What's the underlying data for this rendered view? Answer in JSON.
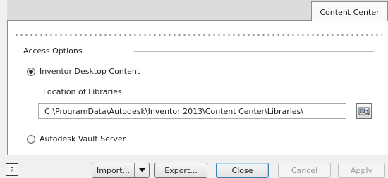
{
  "tabs": {
    "active_label": "Content Center"
  },
  "access_options": {
    "title": "Access Options",
    "desktop_radio": {
      "label": "Inventor Desktop Content",
      "selected": true
    },
    "location_label": "Location of Libraries:",
    "path_value": "C:\\ProgramData\\Autodesk\\Inventor 2013\\Content Center\\Libraries\\",
    "browse_icon": "folder-browse-icon",
    "vault_radio": {
      "label": "Autodesk Vault Server",
      "selected": false
    }
  },
  "footer": {
    "help_icon": "question-mark-icon",
    "import_label": "Import...",
    "export_label": "Export...",
    "close_label": "Close",
    "cancel_label": "Cancel",
    "apply_label": "Apply"
  }
}
